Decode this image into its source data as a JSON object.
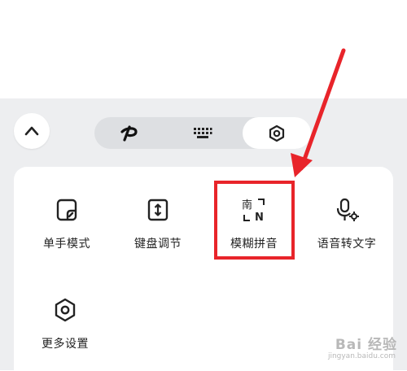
{
  "toolbar": {
    "tabs": [
      {
        "icon": "pinyin-logo-icon",
        "active": false
      },
      {
        "icon": "keyboard-icon",
        "active": false
      },
      {
        "icon": "settings-hexagon-icon",
        "active": true
      }
    ]
  },
  "menu": {
    "items": [
      {
        "icon": "one-hand-mode-icon",
        "label": "单手模式"
      },
      {
        "icon": "keyboard-adjust-icon",
        "label": "键盘调节"
      },
      {
        "icon": "fuzzy-pinyin-icon",
        "label": "模糊拼音",
        "icon_text_top": "南",
        "icon_text_bottom": "N"
      },
      {
        "icon": "voice-to-text-icon",
        "label": "语音转文字"
      },
      {
        "icon": "settings-hexagon-icon",
        "label": "更多设置"
      }
    ]
  },
  "annotation": {
    "color": "#e8242a"
  },
  "watermark": {
    "brand": "Bai 经验",
    "site": "jingyan.baidu.com"
  }
}
